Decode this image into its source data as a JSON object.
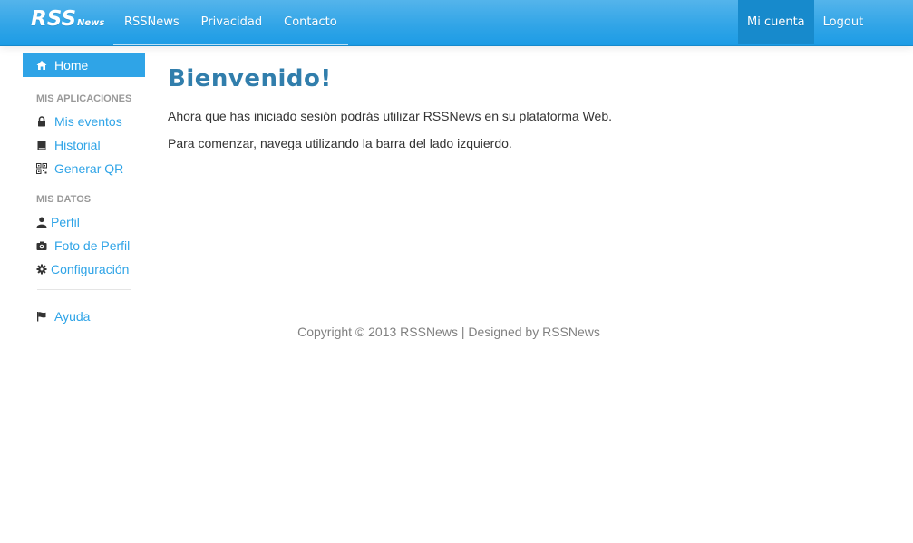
{
  "navbar": {
    "brand_main": "RSS",
    "brand_sub": "News",
    "links": [
      "RSSNews",
      "Privacidad",
      "Contacto"
    ],
    "account_label": "Mi cuenta",
    "logout_label": "Logout"
  },
  "sidebar": {
    "home_label": "Home",
    "section_apps": "MIS APLICACIONES",
    "apps": [
      {
        "label": "Mis eventos",
        "icon": "lock-icon"
      },
      {
        "label": "Historial",
        "icon": "book-icon"
      },
      {
        "label": "Generar QR",
        "icon": "qrcode-icon"
      }
    ],
    "section_data": "MIS DATOS",
    "data_items": [
      {
        "label": "Perfil",
        "icon": "user-icon"
      },
      {
        "label": "Foto de Perfil",
        "icon": "camera-icon"
      },
      {
        "label": "Configuración",
        "icon": "cog-icon"
      }
    ],
    "help_label": "Ayuda"
  },
  "main": {
    "title": "Bienvenido!",
    "paragraph1": "Ahora que has iniciado sesión podrás utilizar RSSNews en su plataforma Web.",
    "paragraph2": "Para comenzar, navega utilizando la barra del lado izquierdo."
  },
  "footer": {
    "text": "Copyright © 2013 RSSNews | Designed by RSSNews"
  },
  "colors": {
    "accent": "#2fa4e7",
    "title": "#317eac",
    "active_nav": "#178acc"
  }
}
